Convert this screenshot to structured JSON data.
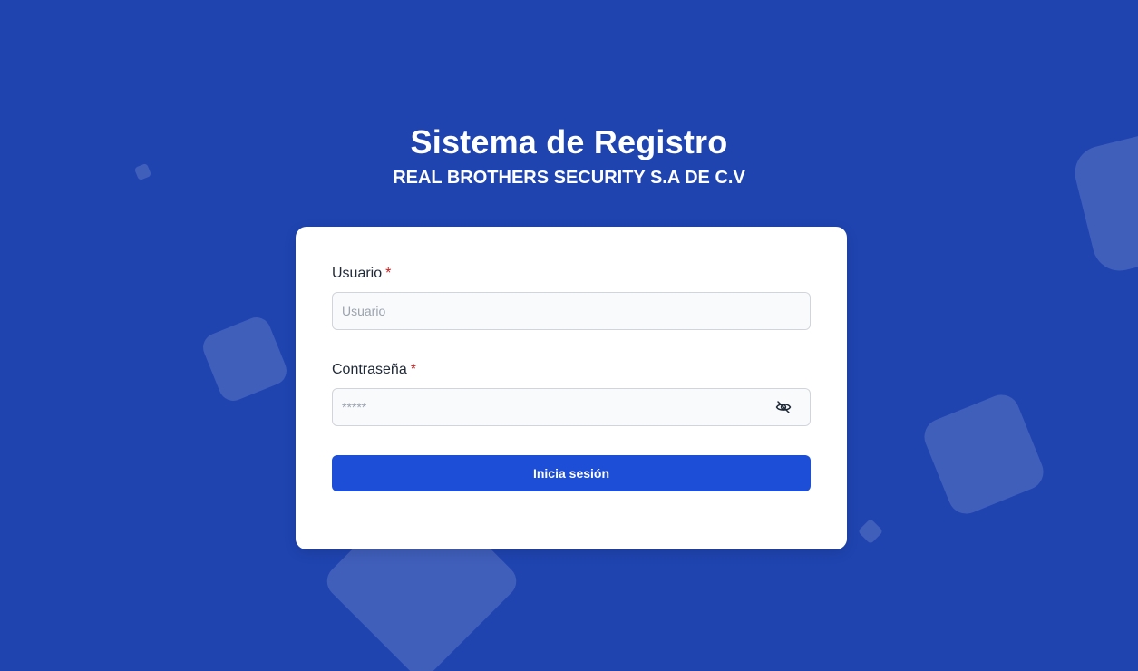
{
  "header": {
    "title": "Sistema de Registro",
    "subtitle": "REAL BROTHERS SECURITY S.A DE C.V"
  },
  "form": {
    "username": {
      "label": "Usuario",
      "required_mark": "*",
      "placeholder": "Usuario",
      "value": ""
    },
    "password": {
      "label": "Contraseña",
      "required_mark": "*",
      "placeholder": "*****",
      "value": "",
      "toggle_icon": "eye-off-icon"
    },
    "submit_label": "Inicia sesión"
  },
  "colors": {
    "background": "#1f44b0",
    "button": "#1d4ed8",
    "required": "#c81e1e"
  }
}
